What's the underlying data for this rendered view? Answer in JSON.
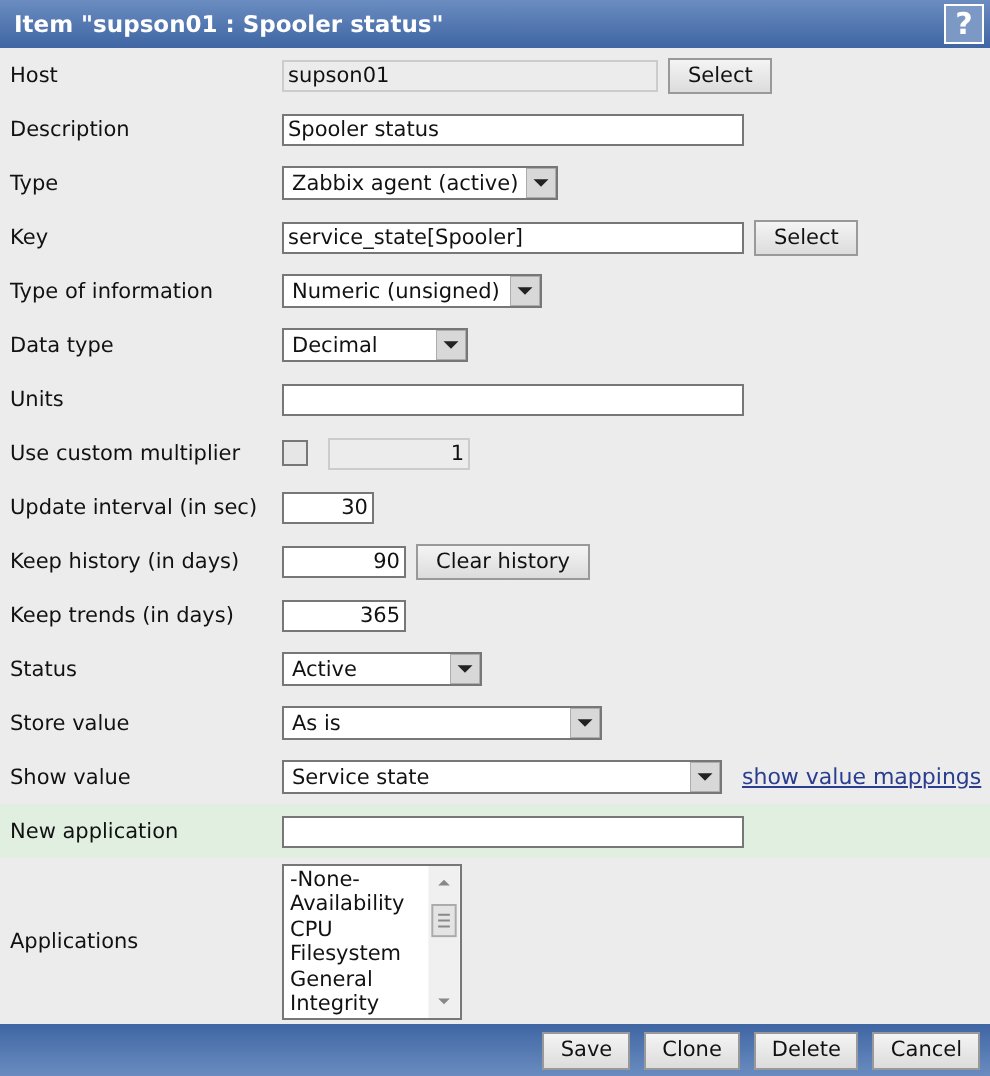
{
  "window": {
    "title": "Item \"supson01 : Spooler status\"",
    "help": "?"
  },
  "rows": [
    {
      "kind": "readonly",
      "label": "Host",
      "value": "supson01",
      "button": "Select"
    },
    {
      "kind": "text",
      "label": "Description",
      "value": "Spooler status"
    },
    {
      "kind": "select",
      "label": "Type",
      "value": "Zabbix agent (active)"
    },
    {
      "kind": "text",
      "label": "Key",
      "value": "service_state[Spooler]",
      "button": "Select"
    },
    {
      "kind": "select",
      "label": "Type of information",
      "value": "Numeric (unsigned)"
    },
    {
      "kind": "select",
      "label": "Data type",
      "value": "Decimal"
    },
    {
      "kind": "text",
      "label": "Units"
    },
    {
      "kind": "multiplier",
      "label": "Use custom multiplier",
      "checked": false,
      "value": "1"
    },
    {
      "kind": "number",
      "label": "Update interval (in sec)",
      "value": "30"
    },
    {
      "kind": "number",
      "label": "Keep history (in days)",
      "value": "90",
      "button": "Clear history"
    },
    {
      "kind": "number",
      "label": "Keep trends (in days)",
      "value": "365"
    },
    {
      "kind": "select",
      "label": "Status",
      "value": "Active"
    },
    {
      "kind": "select",
      "label": "Store value",
      "value": "As is"
    },
    {
      "kind": "select",
      "label": "Show value",
      "value": "Service state",
      "link": "show value mappings"
    },
    {
      "kind": "text",
      "label": "New application",
      "highlighted": true
    },
    {
      "kind": "listbox",
      "label": "Applications",
      "options": [
        "-None-",
        "Availability",
        "CPU",
        "Filesystem",
        "General",
        "Integrity"
      ]
    }
  ],
  "buttons": [
    "Save",
    "Clone",
    "Delete",
    "Cancel"
  ]
}
